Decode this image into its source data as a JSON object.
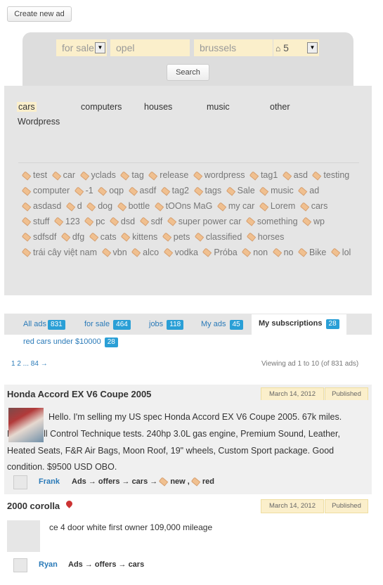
{
  "toolbar": {
    "create_label": "Create new ad"
  },
  "search": {
    "type_value": "for sale",
    "query_value": "opel",
    "location_value": "brussels",
    "radius_value": "5",
    "search_label": "Search"
  },
  "categories": [
    "cars",
    "computers",
    "houses",
    "music",
    "other",
    "Wordpress"
  ],
  "tags": [
    "test",
    "car",
    "yclads",
    "tag",
    "release",
    "wordpress",
    "tag1",
    "asd",
    "testing",
    "computer",
    "-1",
    "oqp",
    "asdf",
    "tag2",
    "tags",
    "Sale",
    "music",
    "ad",
    "asdasd",
    "d",
    "dog",
    "bottle",
    "tOOns MaG",
    "my car",
    "Lorem",
    "cars",
    "stuff",
    "123",
    "pc",
    "dsd",
    "sdf",
    "super power car",
    "something",
    "wp",
    "sdfsdf",
    "dfg",
    "cats",
    "kittens",
    "pets",
    "classified",
    "horses",
    "trái cây việt nam",
    "vbn",
    "alco",
    "vodka",
    "Próba",
    "non",
    "no",
    "Bike",
    "lol"
  ],
  "tabs": [
    {
      "label": "All ads",
      "count": "831"
    },
    {
      "label": "for sale",
      "count": "464"
    },
    {
      "label": "jobs",
      "count": "118"
    },
    {
      "label": "My ads",
      "count": "45"
    },
    {
      "label": "My subscriptions",
      "count": "28"
    }
  ],
  "subscription": {
    "label": "red cars under $10000",
    "count": "28"
  },
  "pager": {
    "text": "1 2 ... 84 →",
    "viewing": "Viewing ad 1 to 10 (of 831 ads)"
  },
  "ads": [
    {
      "title": "Honda Accord EX V6 Coupe 2005",
      "date": "March 14, 2012",
      "status": "Published",
      "description": "Hello. I'm selling my US spec Honda Accord EX V6 Coupe 2005. 67k miles. Passed all Control Technique tests. 240hp 3.0L gas engine, Premium Sound, Leather, Heated Seats, F&R Air Bags, Moon Roof, 19\" wheels, Custom Sport package. Good condition. $9500 USD OBO.",
      "author": "Frank",
      "crumb": "Ads → offers → cars →",
      "tags": [
        "new",
        "red"
      ]
    },
    {
      "title": "2000 corolla",
      "date": "March 14, 2012",
      "status": "Published",
      "description": "ce 4 door white first owner 109,000 mileage",
      "author": "Ryan",
      "crumb": "Ads → offers → cars"
    }
  ]
}
